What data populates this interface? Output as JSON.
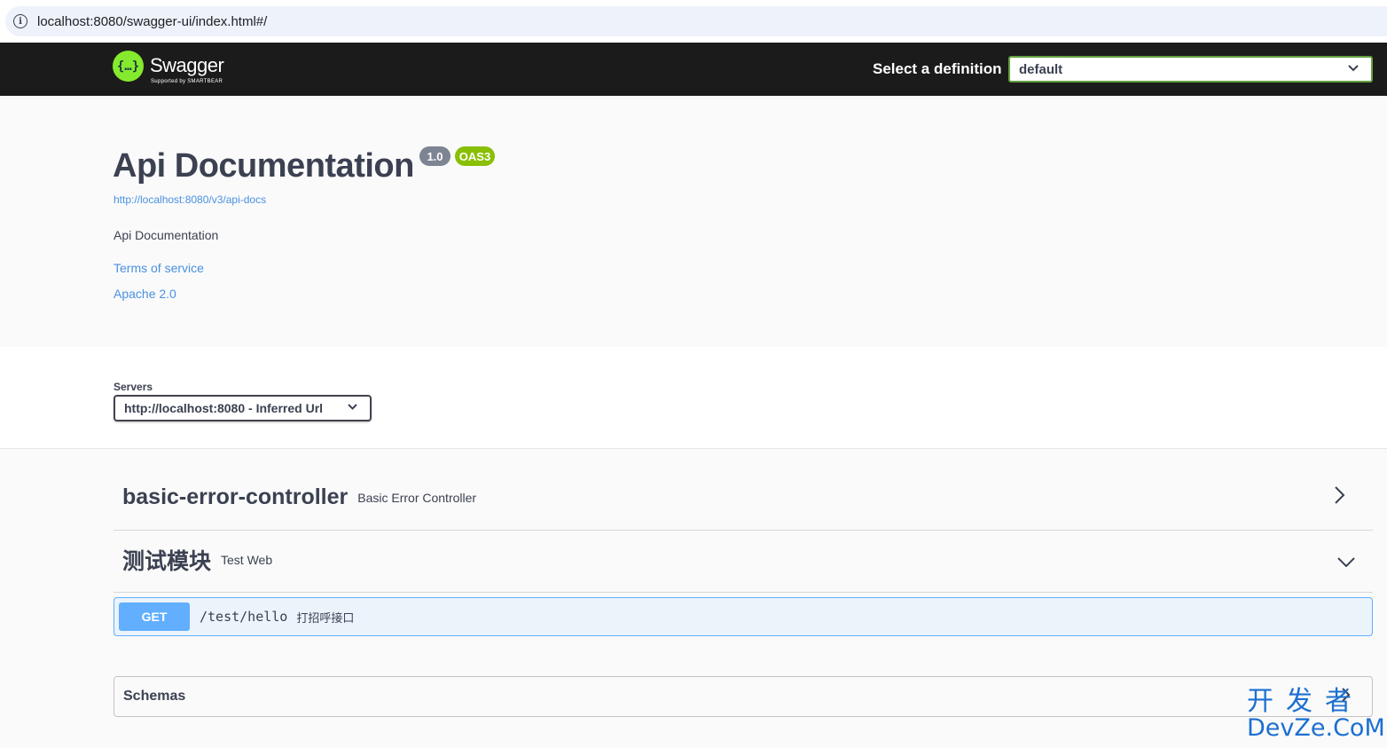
{
  "browser": {
    "url": "localhost:8080/swagger-ui/index.html#/"
  },
  "topbar": {
    "logo_glyph": "{…}",
    "logo_text": "Swagger",
    "logo_sub": "Supported by SMARTBEAR",
    "definition_label": "Select a definition",
    "definition_value": "default"
  },
  "info": {
    "title": "Api Documentation",
    "version": "1.0",
    "oas": "OAS3",
    "api_url": "http://localhost:8080/v3/api-docs",
    "description": "Api Documentation",
    "terms": "Terms of service",
    "license": "Apache 2.0"
  },
  "servers": {
    "label": "Servers",
    "value": "http://localhost:8080 - Inferred Url"
  },
  "tags": [
    {
      "name": "basic-error-controller",
      "description": "Basic Error Controller",
      "expanded": false
    },
    {
      "name": "测试模块",
      "description": "Test Web",
      "expanded": true
    }
  ],
  "operation": {
    "method": "GET",
    "path": "/test/hello",
    "summary": "打招呼接口"
  },
  "schemas": {
    "label": "Schemas"
  },
  "watermark": {
    "top": "开发者",
    "bottom": "DevZe.CoM"
  },
  "colors": {
    "get": "#61affe",
    "oas": "#89bf04",
    "topbar": "#1b1b1b",
    "link": "#4990e2"
  }
}
